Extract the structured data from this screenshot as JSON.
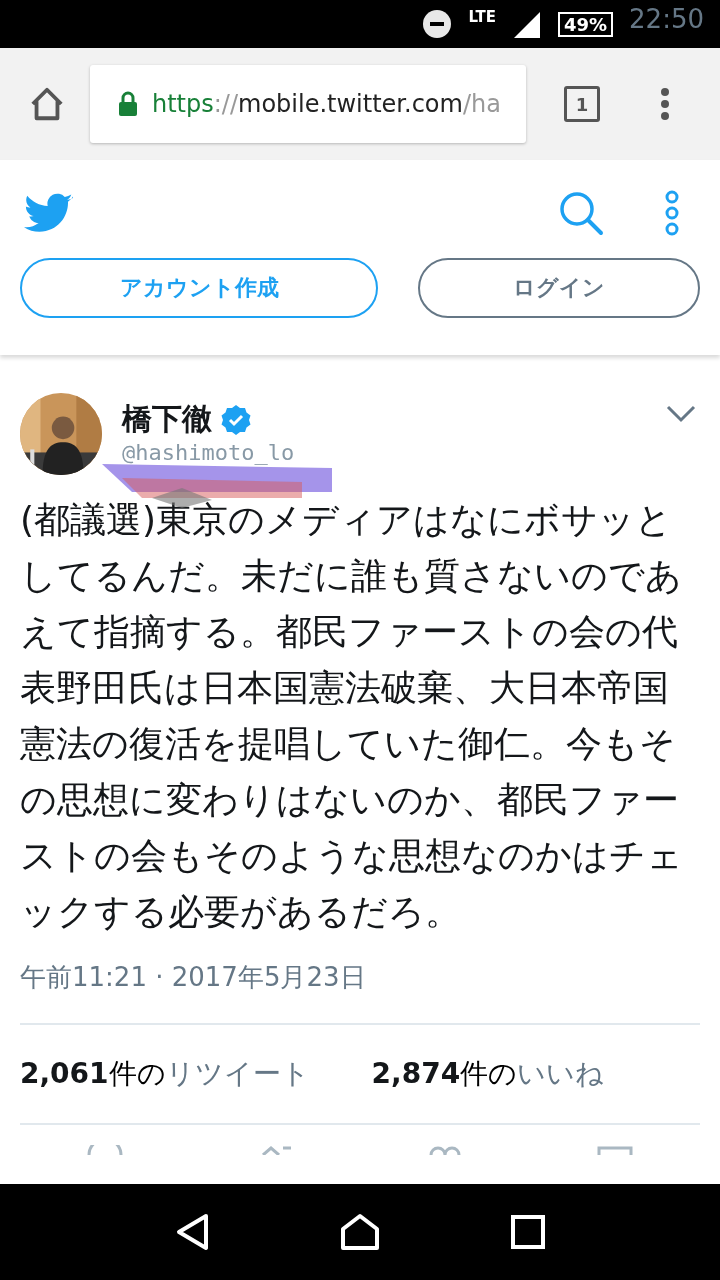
{
  "status_bar": {
    "network": "LTE",
    "battery": "49%",
    "time": "22:50"
  },
  "browser": {
    "url_scheme": "https",
    "url_sep": "://",
    "url_host": "mobile.twitter.com",
    "url_path": "/ha",
    "tab_count": "1"
  },
  "header": {
    "buttons": [
      {
        "label": "アカウント作成",
        "kind": "primary"
      },
      {
        "label": "ログイン",
        "kind": "secondary"
      }
    ]
  },
  "tweet": {
    "name": "橋下徹",
    "verified": true,
    "handle": "@hashimoto_lo",
    "text": "(都議選)東京のメディアはなにボサッとしてるんだ。未だに誰も質さないのであえて指摘する。都民ファーストの会の代表野田氏は日本国憲法破棄、大日本帝国憲法の復活を提唱していた御仁。今もその思想に変わりはないのか、都民ファーストの会もそのような思想なのかはチェックする必要があるだろ。",
    "timestamp": "午前11:21 · 2017年5月23日",
    "stats": [
      {
        "count": "2,061",
        "unit": "件の",
        "label": "リツイート"
      },
      {
        "count": "2,874",
        "unit": "件の",
        "label": "いいね"
      }
    ]
  }
}
